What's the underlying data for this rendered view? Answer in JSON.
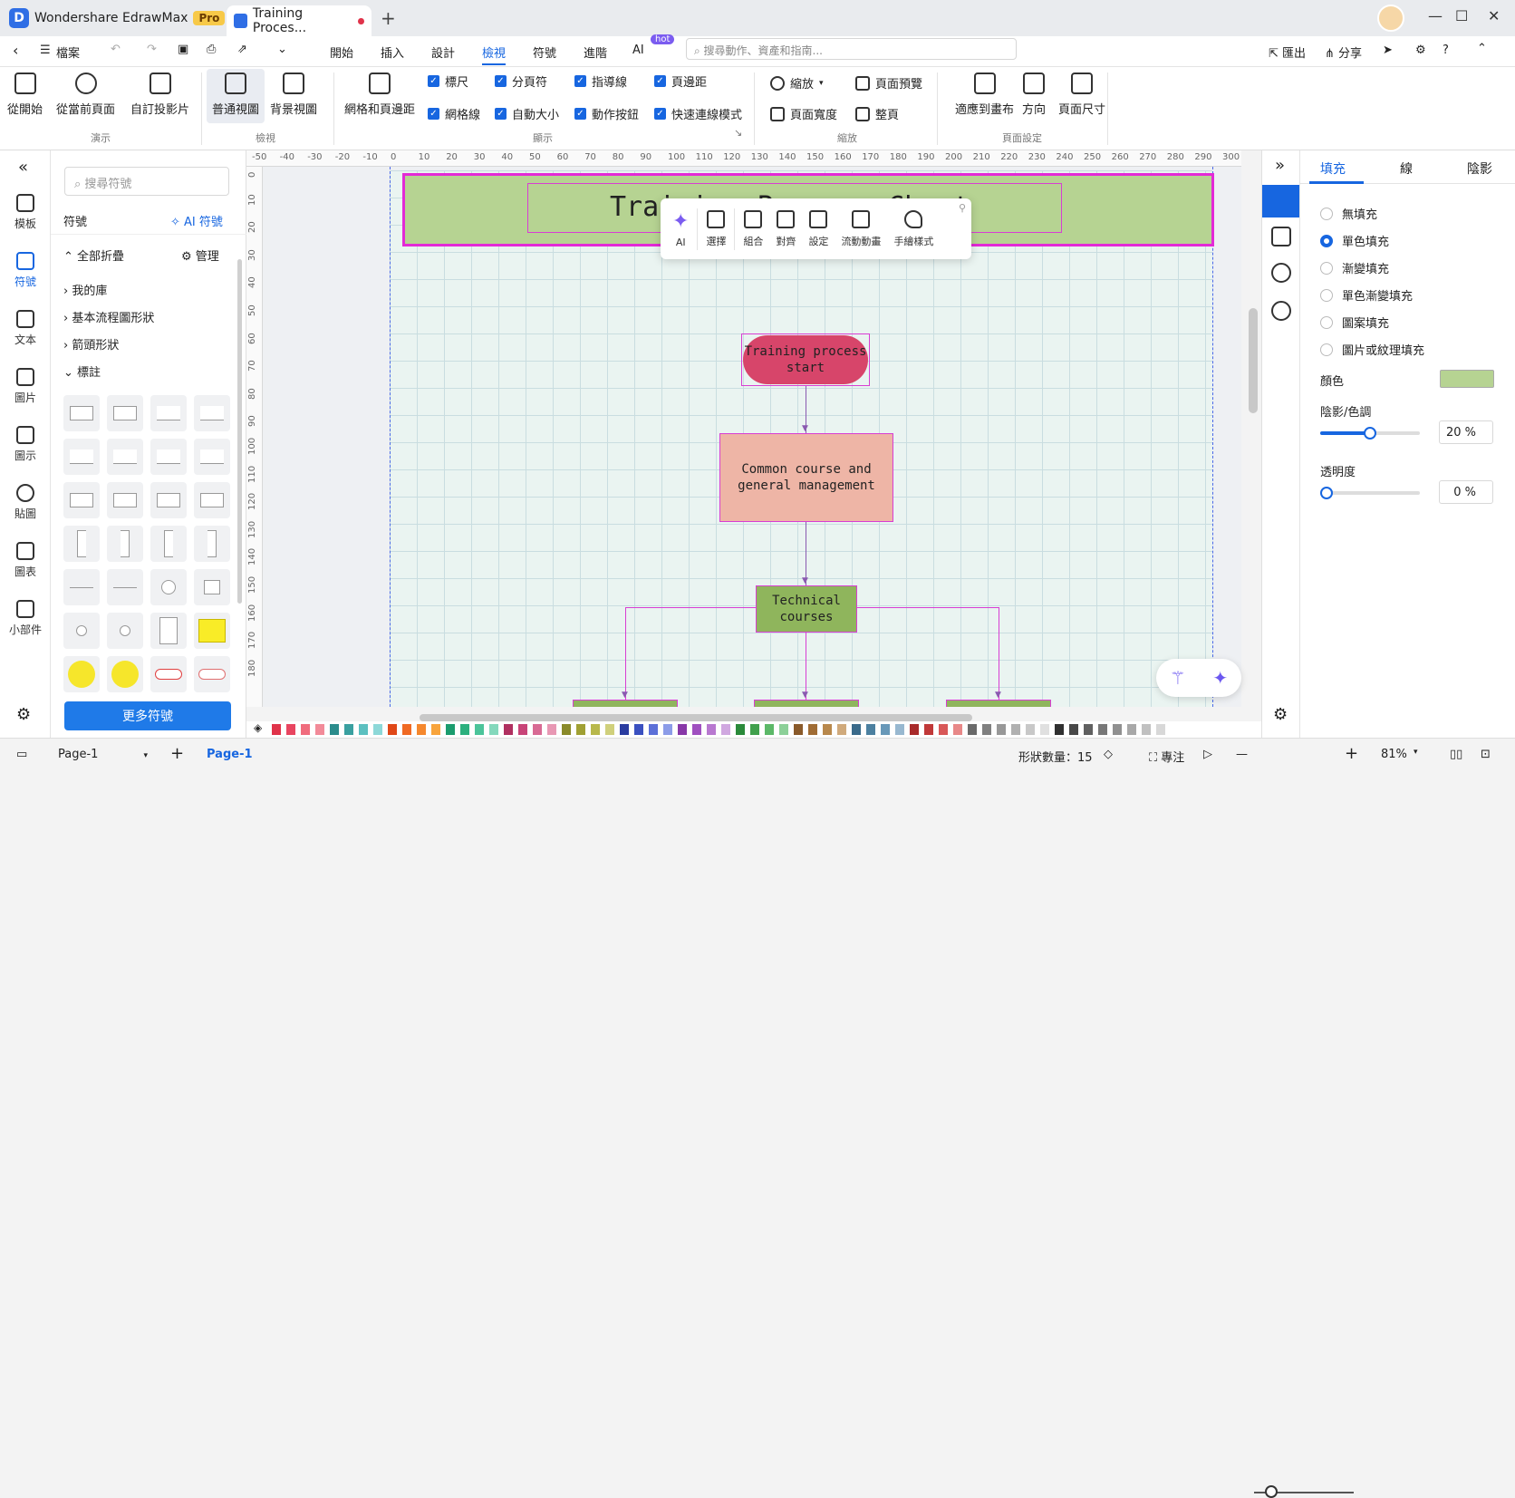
{
  "app": {
    "name": "Wondershare EdrawMax",
    "badge": "Pro",
    "doc_tab": "Training Proces..."
  },
  "menu": {
    "file": "檔案",
    "items": [
      "開始",
      "插入",
      "設計",
      "檢視",
      "符號",
      "進階",
      "AI"
    ],
    "active": "檢視",
    "hot": "hot",
    "search_placeholder": "搜尋動作、資產和指南...",
    "export": "匯出",
    "share": "分享"
  },
  "ribbon": {
    "present": [
      "從開始",
      "從當前頁面",
      "自訂投影片"
    ],
    "present_group": "演示",
    "views": [
      "普通視圖",
      "背景視圖"
    ],
    "views_group": "檢視",
    "grid": "網格和頁邊距",
    "checks": [
      "標尺",
      "分頁符",
      "指導線",
      "頁邊距",
      "網格線",
      "自動大小",
      "動作按鈕",
      "快速連線模式"
    ],
    "display_group": "顯示",
    "zoom": "縮放",
    "page_width": "頁面寬度",
    "page_preview": "頁面預覽",
    "whole_page": "整頁",
    "zoom_group": "縮放",
    "fit": "適應到畫布",
    "orient": "方向",
    "size": "頁面尺寸",
    "page_group": "頁面設定"
  },
  "rail": [
    "模板",
    "符號",
    "文本",
    "圖片",
    "圖示",
    "貼圖",
    "圖表",
    "小部件"
  ],
  "symbols": {
    "search": "搜尋符號",
    "title": "符號",
    "ai": "AI 符號",
    "collapse": "全部折疊",
    "manage": "管理",
    "libs": [
      "我的庫",
      "基本流程圖形狀",
      "箭頭形狀",
      "標註"
    ],
    "more": "更多符號"
  },
  "ruler_h": [
    "-50",
    "-40",
    "-30",
    "-20",
    "-10",
    "0",
    "10",
    "20",
    "30",
    "40",
    "50",
    "60",
    "70",
    "80",
    "90",
    "100",
    "110",
    "120",
    "130",
    "140",
    "150",
    "160",
    "170",
    "180",
    "190",
    "200",
    "210",
    "220",
    "230",
    "240",
    "250",
    "260",
    "270",
    "280",
    "290",
    "300"
  ],
  "ruler_v": [
    "0",
    "10",
    "20",
    "30",
    "40",
    "50",
    "60",
    "70",
    "80",
    "90",
    "100",
    "110",
    "120",
    "130",
    "140",
    "150",
    "160",
    "170",
    "180"
  ],
  "diagram": {
    "title": "Training Process Chart",
    "start": "Training process start",
    "common": "Common course and general management",
    "tech": "Technical courses"
  },
  "floatbar": [
    "AI",
    "選擇",
    "組合",
    "對齊",
    "設定",
    "流動動畫",
    "手繪樣式"
  ],
  "props": {
    "tabs": [
      "填充",
      "線",
      "陰影"
    ],
    "fills": [
      "無填充",
      "單色填充",
      "漸變填充",
      "單色漸變填充",
      "圖案填充",
      "圖片或紋理填充"
    ],
    "color_label": "顏色",
    "color": "#b6d392",
    "shade_label": "陰影/色調",
    "shade": "20 %",
    "shade_value": 0.2,
    "transp_label": "透明度",
    "transp": "0 %",
    "transp_value": 0
  },
  "status": {
    "page_select": "Page-1",
    "page_tab": "Page-1",
    "shapes": "形狀數量：15",
    "focus": "專注",
    "zoom": "81%"
  },
  "palette": [
    "#e0334a",
    "#e84560",
    "#f06c7d",
    "#f28b99",
    "#2b8c8c",
    "#3aa0a0",
    "#5cc0c0",
    "#8dd8d8",
    "#e04818",
    "#f06a24",
    "#f5882e",
    "#f8a43c",
    "#1b9c6e",
    "#2cb07e",
    "#4cc49a",
    "#84d8bc",
    "#b03060",
    "#c84478",
    "#d86a94",
    "#e898b4",
    "#8a8a2a",
    "#a0a034",
    "#b8b84c",
    "#d0d07c",
    "#2a3ca0",
    "#3a50c0",
    "#5c70d8",
    "#8c9ce8",
    "#8838a8",
    "#a050c0",
    "#b878d0",
    "#d0a8e0",
    "#2a8a3a",
    "#40a04c",
    "#5cb868",
    "#8cd098",
    "#8a5a2a",
    "#a06c34",
    "#b8884c",
    "#d0aa7c",
    "#3a6a8a",
    "#4c80a0",
    "#6898b8",
    "#98b8d0",
    "#a82a2a",
    "#c03838",
    "#d85858",
    "#e88888",
    "#6a6a6a",
    "#808080",
    "#989898",
    "#b0b0b0",
    "#c8c8c8",
    "#e0e0e0",
    "#303030",
    "#484848",
    "#606060",
    "#787878",
    "#909090",
    "#a8a8a8",
    "#c0c0c0",
    "#d8d8d8"
  ]
}
